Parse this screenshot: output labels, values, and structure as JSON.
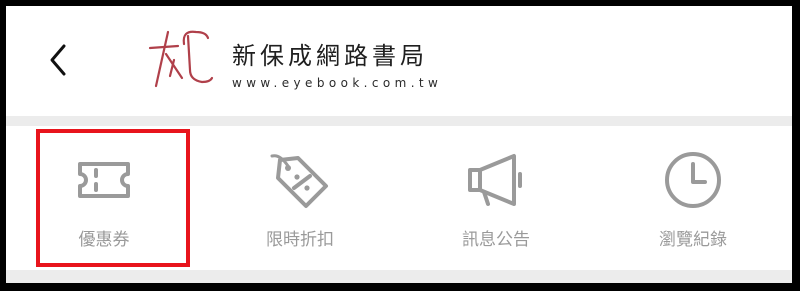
{
  "header": {
    "brand_name": "新保成網路書局",
    "brand_url": "www.eyebook.com.tw"
  },
  "icons": {
    "back": "chevron-left-icon",
    "logo": "eyebook-logo"
  },
  "menu": {
    "items": [
      {
        "label": "優惠券",
        "icon": "ticket-icon"
      },
      {
        "label": "限時折扣",
        "icon": "discount-tag-icon"
      },
      {
        "label": "訊息公告",
        "icon": "megaphone-icon"
      },
      {
        "label": "瀏覽紀錄",
        "icon": "clock-icon"
      }
    ]
  },
  "colors": {
    "logo": "#b0404a",
    "icon": "#9a9a9a",
    "highlight": "#e8141c",
    "divider": "#ececec"
  }
}
